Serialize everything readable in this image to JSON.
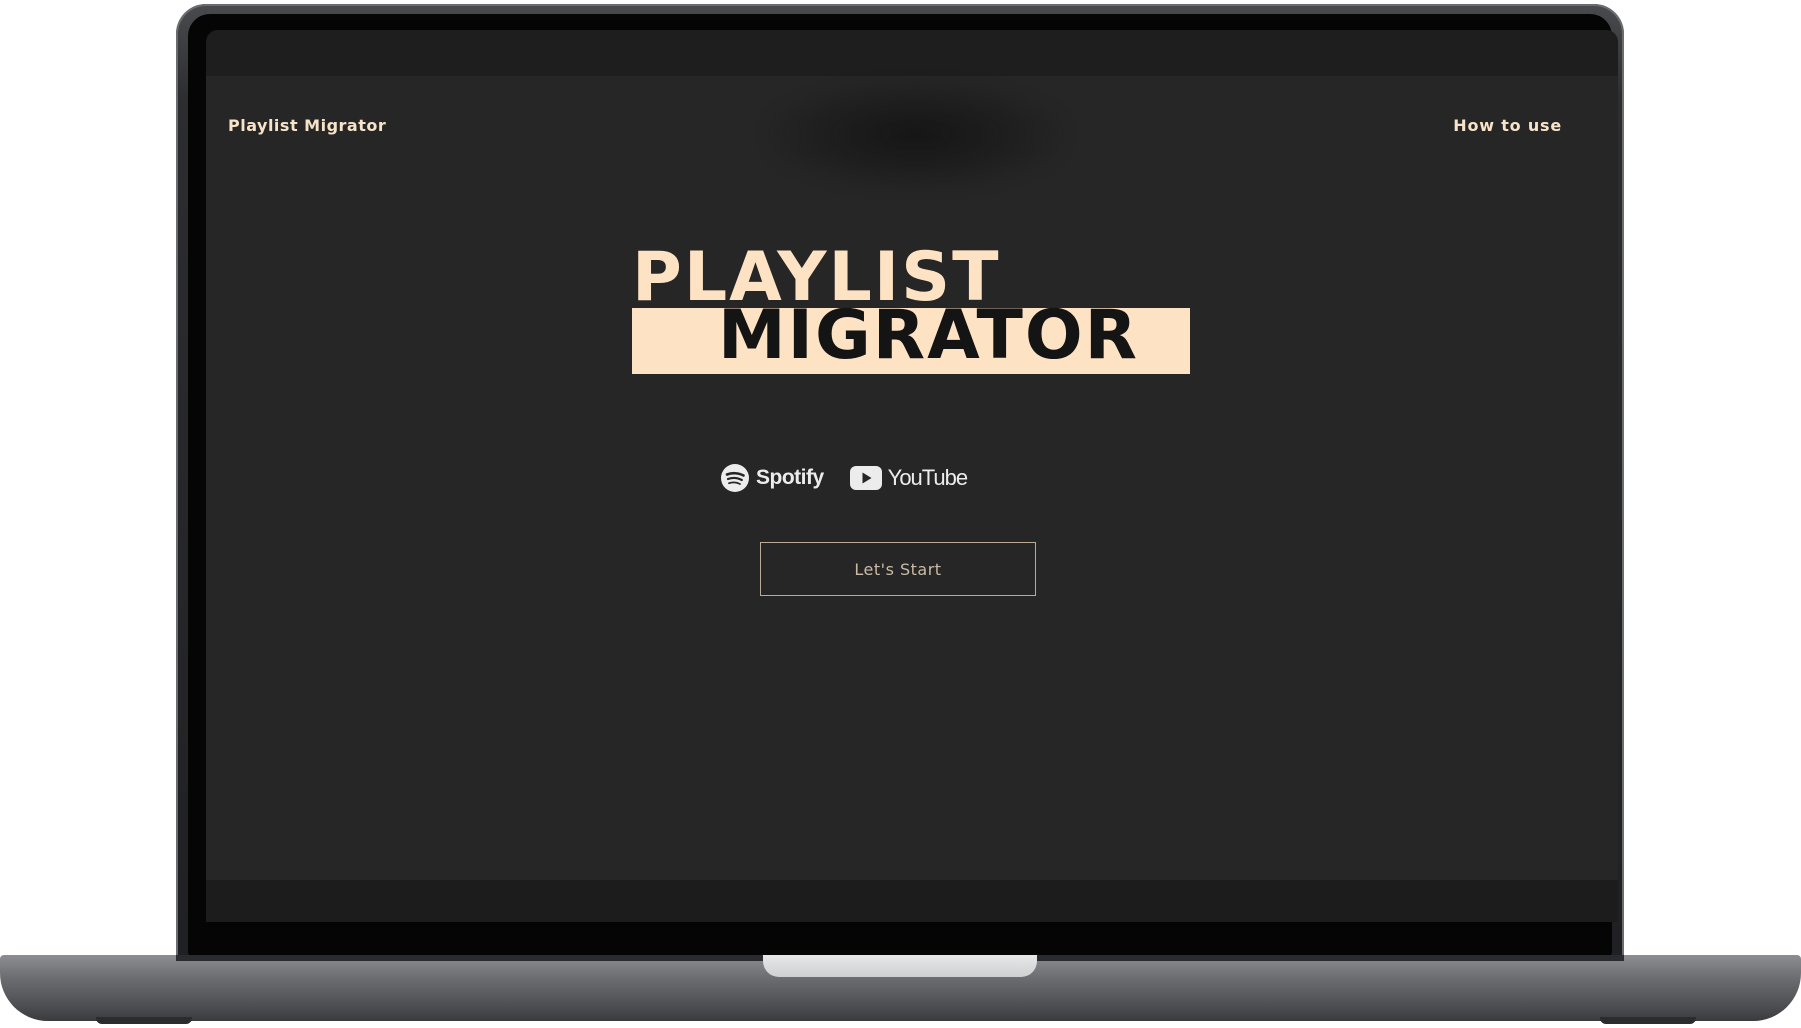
{
  "nav": {
    "brand": "Playlist Migrator",
    "how_to_use": "How to use"
  },
  "hero": {
    "title_line1": "PLAYLIST",
    "title_line2": "MIGRATOR"
  },
  "services": [
    {
      "name": "Spotify",
      "icon": "spotify-icon"
    },
    {
      "name": "YouTube",
      "icon": "youtube-play-icon"
    }
  ],
  "cta": {
    "label": "Let's Start"
  },
  "colors": {
    "accent": "#fde2c3",
    "background": "#262626",
    "button_border": "#b9ab97"
  }
}
